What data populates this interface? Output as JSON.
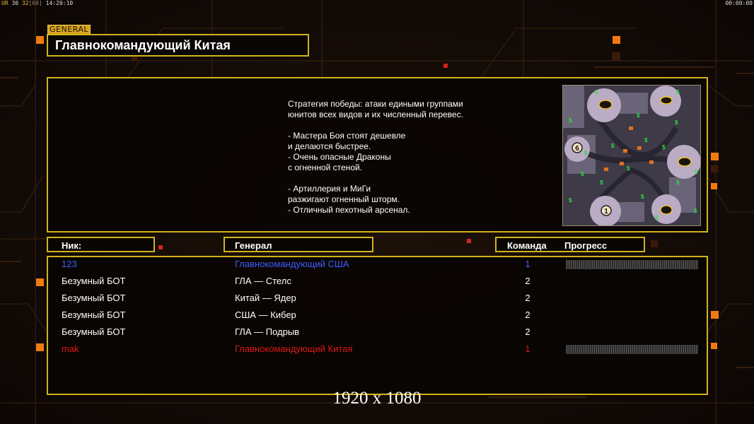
{
  "hud": {
    "top_left_prefix": "UR",
    "top_left_a": "30",
    "top_left_b": "32",
    "top_left_c": "[60]",
    "top_left_time": "14:20:10",
    "top_right_time": "00:00:00"
  },
  "general_tag": "GENERAL",
  "title": "Главнокомандующий Китая",
  "strategy_text": "Стратегия победы: атаки едиными группами\nюнитов всех видов и их численный перевес.\n\n- Мастера Боя стоят дешевле\nи делаются быстрее.\n- Очень опасные Драконы\nс огненной стеной.\n\n- Артиллерия и МиГи\nразжигают огненный шторм.\n- Отличный пехотный арсенал.",
  "minimap": {
    "markers": [
      "6",
      "1"
    ]
  },
  "headers": {
    "nick": "Ник:",
    "general": "Генерал",
    "team": "Команда",
    "progress": "Прогресс"
  },
  "players": [
    {
      "nick": "123",
      "general": "Главнокомандующий США",
      "team": "1",
      "color": "#3d5fff",
      "has_progress": true
    },
    {
      "nick": "Безумный БОТ",
      "general": "ГЛА — Стелс",
      "team": "2",
      "color": "#ffffff",
      "has_progress": false
    },
    {
      "nick": "Безумный БОТ",
      "general": "Китай — Ядер",
      "team": "2",
      "color": "#ffffff",
      "has_progress": false
    },
    {
      "nick": "Безумный БОТ",
      "general": "США — Кибер",
      "team": "2",
      "color": "#ffffff",
      "has_progress": false
    },
    {
      "nick": "Безумный БОТ",
      "general": "ГЛА — Подрыв",
      "team": "2",
      "color": "#ffffff",
      "has_progress": false
    },
    {
      "nick": "mak",
      "general": "Главнокомандующий Китая",
      "team": "1",
      "color": "#e01818",
      "has_progress": true
    }
  ],
  "resolution_label": "1920 x 1080",
  "colors": {
    "frame": "#d1b31b",
    "accent_orange": "#f07a10",
    "player_blue": "#3d5fff",
    "player_red": "#e01818"
  }
}
